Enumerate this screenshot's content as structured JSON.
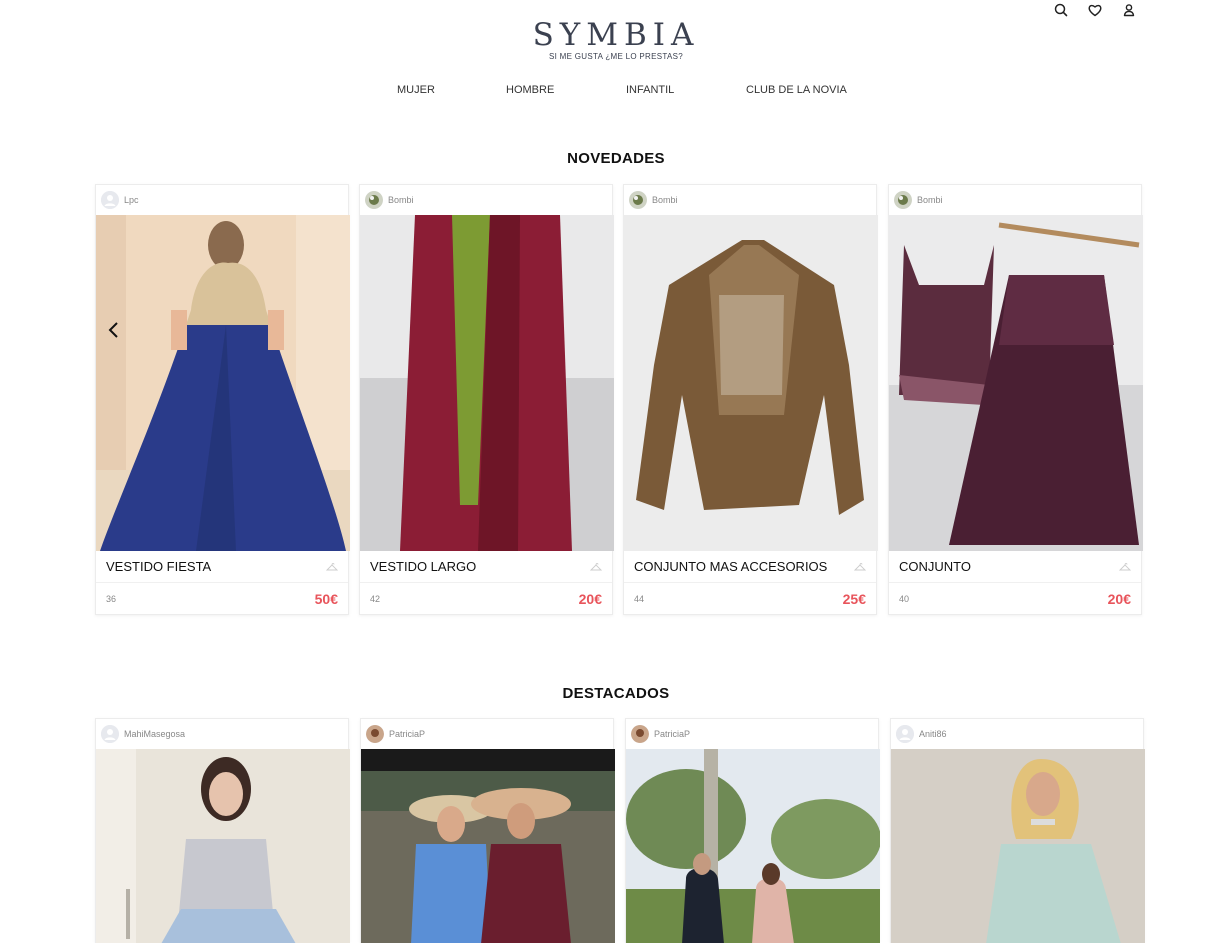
{
  "brand": {
    "name": "SYMBIA",
    "tagline": "SI ME GUSTA ¿ME LO PRESTAS?"
  },
  "header_icons": [
    "search-icon",
    "heart-icon",
    "user-icon"
  ],
  "nav": {
    "items": [
      {
        "label": "MUJER"
      },
      {
        "label": "HOMBRE"
      },
      {
        "label": "INFANTIL"
      },
      {
        "label": "CLUB DE LA NOVIA"
      }
    ]
  },
  "novedades": {
    "title": "NOVEDADES",
    "cards": [
      {
        "user": "Lpc",
        "title": "VESTIDO FIESTA",
        "size": "36",
        "price": "50€"
      },
      {
        "user": "Bombi",
        "title": "VESTIDO LARGO",
        "size": "42",
        "price": "20€"
      },
      {
        "user": "Bombi",
        "title": "CONJUNTO MAS ACCESORIOS",
        "size": "44",
        "price": "25€"
      },
      {
        "user": "Bombi",
        "title": "CONJUNTO",
        "size": "40",
        "price": "20€"
      }
    ]
  },
  "destacados": {
    "title": "DESTACADOS",
    "cards": [
      {
        "user": "MahiMasegosa"
      },
      {
        "user": "PatriciaP"
      },
      {
        "user": "PatriciaP"
      },
      {
        "user": "Aniti86"
      }
    ]
  },
  "colors": {
    "price": "#e8545b",
    "logo": "#3b4150"
  }
}
